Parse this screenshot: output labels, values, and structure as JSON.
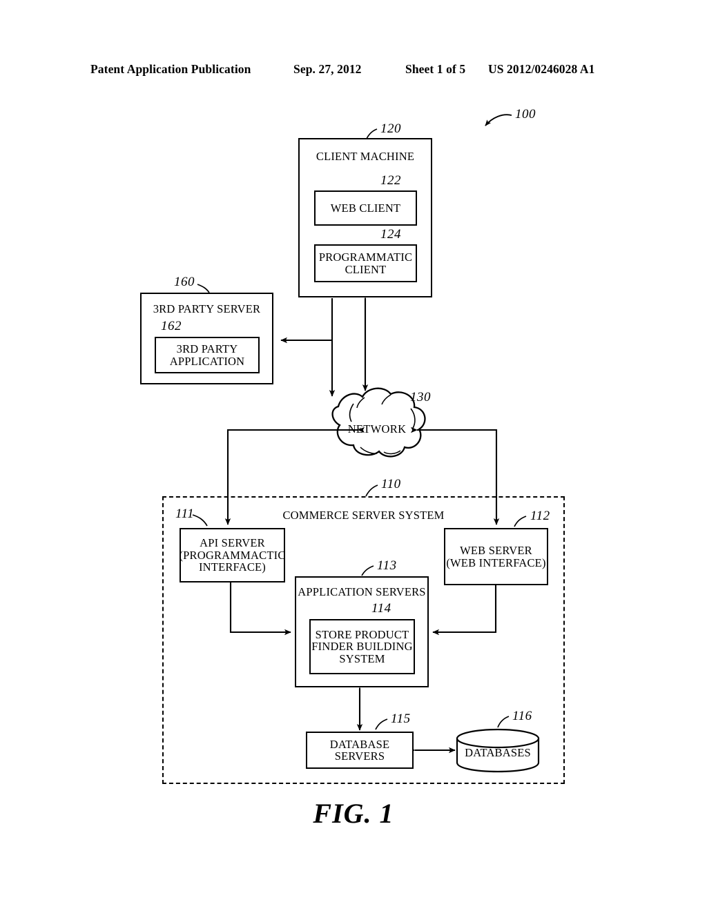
{
  "header": {
    "left": "Patent Application Publication",
    "date": "Sep. 27, 2012",
    "sheet": "Sheet 1 of 5",
    "pub_number": "US 2012/0246028 A1"
  },
  "figure": {
    "caption": "FIG. 1",
    "system_ref": "100"
  },
  "nodes": {
    "client_machine": {
      "label": "CLIENT MACHINE",
      "ref": "120"
    },
    "web_client": {
      "label": "WEB CLIENT",
      "ref": "122"
    },
    "programmatic_client": {
      "label": "PROGRAMMATIC\nCLIENT",
      "ref": "124"
    },
    "third_party_server": {
      "label": "3RD PARTY SERVER",
      "ref": "160"
    },
    "third_party_application": {
      "label": "3RD PARTY\nAPPLICATION",
      "ref": "162"
    },
    "network": {
      "label": "NETWORK",
      "ref": "130"
    },
    "commerce_server_system": {
      "label": "COMMERCE SERVER SYSTEM",
      "ref": "110"
    },
    "api_server": {
      "label": "API SERVER\n(PROGRAMMACTIC\nINTERFACE)",
      "ref": "111"
    },
    "web_server": {
      "label": "WEB SERVER\n(WEB INTERFACE)",
      "ref": "112"
    },
    "application_servers": {
      "label": "APPLICATION SERVERS",
      "ref": "113"
    },
    "store_product_finder": {
      "label": "STORE PRODUCT\nFINDER BUILDING\nSYSTEM",
      "ref": "114"
    },
    "database_servers": {
      "label": "DATABASE\nSERVERS",
      "ref": "115"
    },
    "databases": {
      "label": "DATABASES",
      "ref": "116"
    }
  },
  "colors": {
    "ink": "#000000",
    "paper": "#ffffff"
  }
}
